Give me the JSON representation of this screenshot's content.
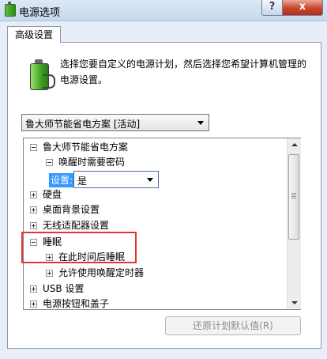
{
  "window": {
    "title": "电源选项",
    "help_button": "?",
    "close_button": "x"
  },
  "tab": {
    "label": "高级设置"
  },
  "description": "选择您要自定义的电源计划，然后选择您希望计算机管理的电源设置。",
  "plan_select": {
    "value": "鲁大师节能省电方案 [活动]"
  },
  "tree": {
    "items": [
      {
        "label": "鲁大师节能省电方案",
        "state": "expanded"
      },
      {
        "label": "唤醒时需要密码",
        "state": "expanded"
      },
      {
        "label": "硬盘",
        "state": "collapsed"
      },
      {
        "label": "桌面背景设置",
        "state": "collapsed"
      },
      {
        "label": "无线适配器设置",
        "state": "collapsed"
      },
      {
        "label": "睡眠",
        "state": "expanded"
      },
      {
        "label": "在此时间后睡眠",
        "state": "collapsed"
      },
      {
        "label": "允许使用唤醒定时器",
        "state": "collapsed"
      },
      {
        "label": "USB 设置",
        "state": "collapsed"
      },
      {
        "label": "电源按钮和盖子",
        "state": "collapsed"
      }
    ],
    "setting": {
      "label": "设置:",
      "value": "是"
    }
  },
  "restore_button": "还原计划默认值(R)",
  "colors": {
    "highlight_box": "#e0352f",
    "selection": "#3399ff",
    "title_bar": "#c6d9ef"
  }
}
